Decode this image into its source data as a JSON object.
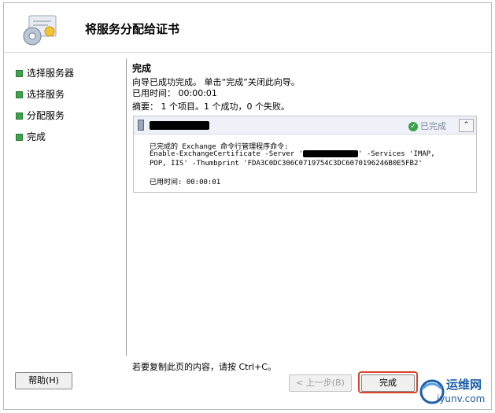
{
  "wizard": {
    "title": "将服务分配给证书"
  },
  "nav": {
    "items": [
      {
        "label": "选择服务器"
      },
      {
        "label": "选择服务"
      },
      {
        "label": "分配服务"
      },
      {
        "label": "完成"
      }
    ]
  },
  "main": {
    "section_title": "完成",
    "intro": "向导已成功完成。 单击“完成”关闭此向导。",
    "elapsed": "已用时间： 00:00:01",
    "summary": "摘要： 1 个项目。1 个成功，0 个失败。",
    "task": {
      "status": "已完成",
      "line1": "已完成的 Exchange 命令行管理程序命令:",
      "line2a": "Enable-ExchangeCertificate -Server '",
      "line2b": "' -Services 'IMAP,",
      "line3": "POP, IIS' -Thumbprint 'FDA3C0DC306C0719754C3DC6070196246B0E5FB2'",
      "elapsed": "已用时间:  00:00:01"
    },
    "copy_hint": "若要复制此页的内容，请按 Ctrl+C。"
  },
  "buttons": {
    "help": "帮助(H)",
    "back": "< 上一步(B)",
    "finish": "完成"
  },
  "watermark": {
    "text": "运维网",
    "url": "iyunv.com"
  },
  "colors": {
    "highlight": "#d9432b",
    "nav_bullet": "#3fa34d",
    "status_check": "#3ea04b"
  }
}
